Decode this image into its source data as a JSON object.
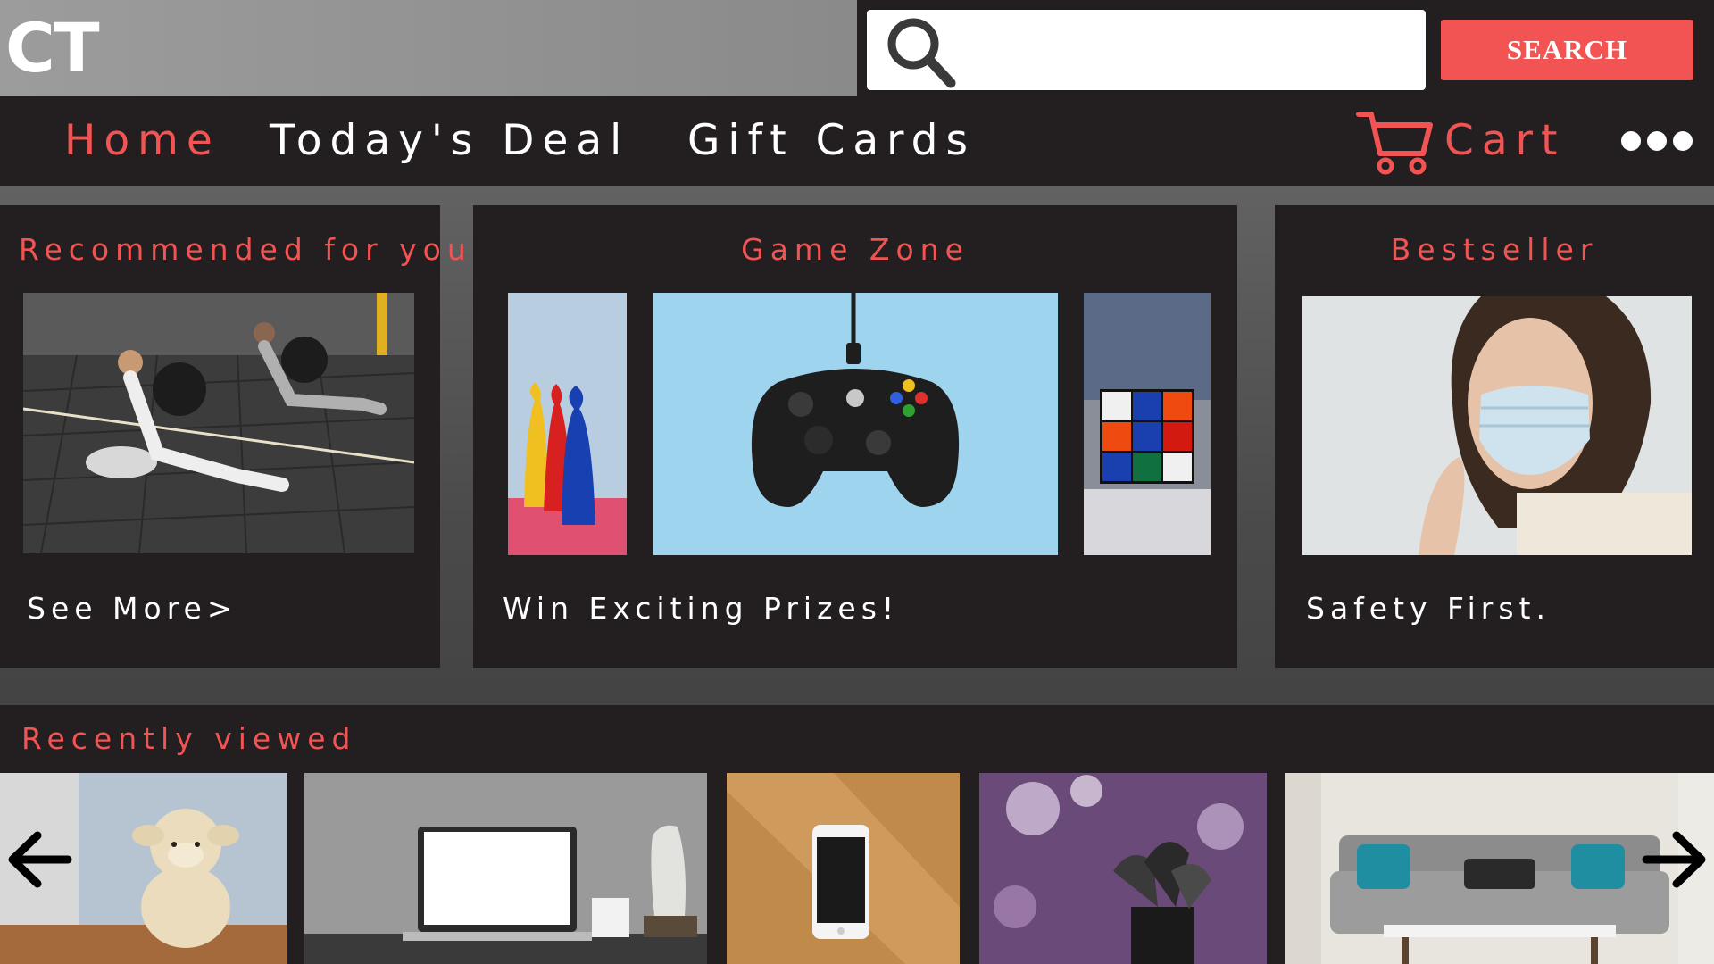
{
  "brand": {
    "logo_text": "CT"
  },
  "search": {
    "placeholder": "",
    "value": "",
    "button_label": "SEARCH"
  },
  "nav": {
    "items": [
      {
        "label": "Home",
        "active": true
      },
      {
        "label": "Today's Deal",
        "active": false
      },
      {
        "label": "Gift Cards",
        "active": false
      }
    ],
    "cart_label": "Cart",
    "more_icon": "more-dots-icon",
    "cart_icon": "shopping-cart-icon"
  },
  "panels": [
    {
      "title": "Recommended for you",
      "caption": "See More>"
    },
    {
      "title": "Game Zone",
      "caption": "Win Exciting Prizes!"
    },
    {
      "title": "Bestseller",
      "caption": "Safety First."
    }
  ],
  "recently_viewed": {
    "title": "Recently viewed",
    "prev_icon": "arrow-left-icon",
    "next_icon": "arrow-right-icon"
  },
  "colors": {
    "accent": "#f25454",
    "bar": "#231f20",
    "text": "#ffffff"
  }
}
